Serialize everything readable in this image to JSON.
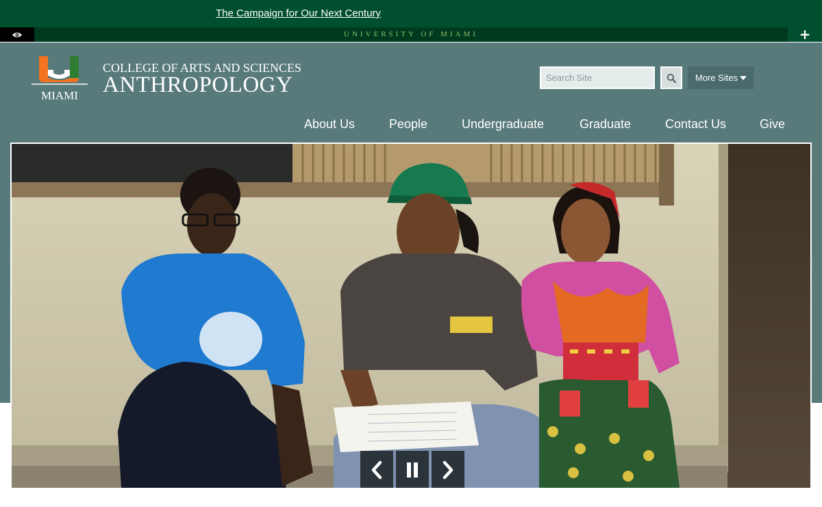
{
  "campaign": {
    "link_text": "The Campaign for Our Next Century"
  },
  "university_bar": {
    "name": "UNIVERSITY OF MIAMI",
    "visibility_icon": "eye-icon",
    "expand_icon": "plus-icon",
    "expand_label": "+"
  },
  "header": {
    "logo": {
      "mark": "U",
      "wordmark": "MIAMI",
      "colors": {
        "orange": "#f47321",
        "green": "#005030"
      }
    },
    "college": "COLLEGE OF ARTS AND SCIENCES",
    "department": "ANTHROPOLOGY",
    "search": {
      "placeholder": "Search Site",
      "value": "",
      "icon": "search-icon"
    },
    "more_sites": {
      "label": "More Sites",
      "icon": "caret-down-icon"
    }
  },
  "nav": {
    "items": [
      "About Us",
      "People",
      "Undergraduate",
      "Graduate",
      "Contact Us",
      "Give"
    ]
  },
  "hero": {
    "image_alt": "Three people seated on a bench reviewing papers",
    "controls": {
      "previous_icon": "chevron-left-icon",
      "pause_icon": "pause-icon",
      "next_icon": "chevron-right-icon"
    }
  },
  "colors": {
    "campaign_bg": "#005030",
    "univ_bar_bg": "#003a1e",
    "header_bg": "#587a7a",
    "accent_orange": "#f47321"
  }
}
